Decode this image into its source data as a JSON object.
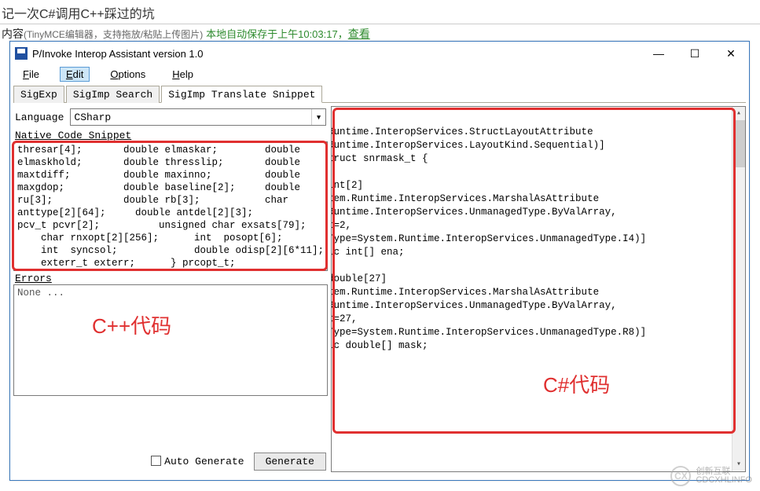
{
  "page": {
    "title": "记一次C#调用C++踩过的坑",
    "content_label": "内容",
    "editor_hint": "(TinyMCE编辑器，支持拖放/粘贴上传图片)",
    "autosave_prefix": "本地自动保存于上午10:03:17，",
    "view_link": "查看"
  },
  "window": {
    "title": "P/Invoke Interop Assistant version 1.0",
    "controls": {
      "min": "—",
      "max": "☐",
      "close": "✕"
    }
  },
  "menu": {
    "file": "File",
    "edit": "Edit",
    "options": "Options",
    "help": "Help"
  },
  "tabs": {
    "sigexp": "SigExp",
    "sigimp_search": "SigImp Search",
    "sigimp_translate": "SigImp Translate Snippet"
  },
  "left": {
    "language_label": "Language",
    "language_value": "CSharp",
    "native_label": "Native Code Snippet",
    "native_code": "thresar[4];       double elmaskar;        double\nelmaskhold;       double thresslip;       double\nmaxtdiff;         double maxinno;         double\nmaxgdop;          double baseline[2];     double\nru[3];            double rb[3];           char\nanttype[2][64];     double antdel[2][3];\npcv_t pcvr[2];          unsigned char exsats[79];\n    char rnxopt[2][256];      int  posopt[6];\n    int  syncsol;             double odisp[2][6*11];\n    exterr_t exterr;      } prcopt_t;",
    "errors_label": "Errors",
    "errors_value": "None ...",
    "auto_generate_label": "Auto Generate",
    "generate_label": "Generate"
  },
  "right": {
    "output_code": "[System.Runtime.InteropServices.StructLayoutAttribute\n(System.Runtime.InteropServices.LayoutKind.Sequential)]\npublic struct snrmask_t {\n\n    /// int[2]\n    [System.Runtime.InteropServices.MarshalAsAttribute\n(System.Runtime.InteropServices.UnmanagedType.ByValArray,\nSizeConst=2,\nArraySubType=System.Runtime.InteropServices.UnmanagedType.I4)]\n    public int[] ena;\n\n    /// double[27]\n    [System.Runtime.InteropServices.MarshalAsAttribute\n(System.Runtime.InteropServices.UnmanagedType.ByValArray,\nSizeConst=27,\nArraySubType=System.Runtime.InteropServices.UnmanagedType.R8)]\n    public double[] mask;\n}"
  },
  "annotations": {
    "cpp_label": "C++代码",
    "csharp_label": "C#代码"
  },
  "watermark": {
    "logo": "CX",
    "line1": "创新互联",
    "line2": "CDCXHLINFO"
  }
}
